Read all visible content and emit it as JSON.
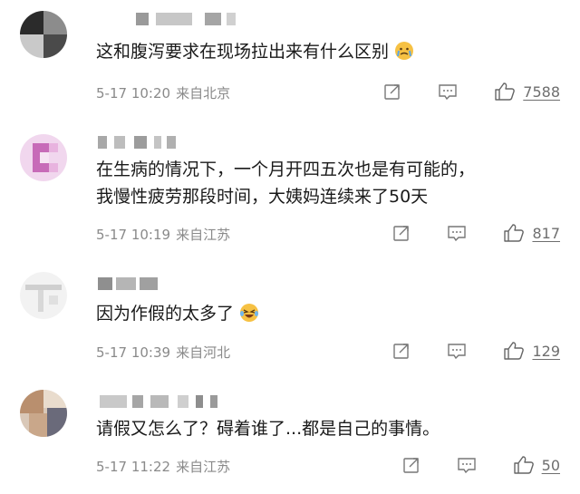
{
  "comments": [
    {
      "text_lines": [
        "这和腹泻要求在现场拉出来有什么区别"
      ],
      "emoji": "crying-face-emoji",
      "date": "5-17",
      "time": "10:20",
      "location": "来自北京",
      "likes": "7588"
    },
    {
      "text_lines": [
        "在生病的情况下，一个月开四五次也是有可能的，",
        "我慢性疲劳那段时间，大姨妈连续来了50天"
      ],
      "emoji": "",
      "date": "5-17",
      "time": "10:19",
      "location": "来自江苏",
      "likes": "817"
    },
    {
      "text_lines": [
        "因为作假的太多了"
      ],
      "emoji": "laughing-crying-emoji",
      "date": "5-17",
      "time": "10:39",
      "location": "来自河北",
      "likes": "129"
    },
    {
      "text_lines": [
        "请假又怎么了？碍着谁了...都是自己的事情。"
      ],
      "emoji": "",
      "date": "5-17",
      "time": "11:22",
      "location": "来自江苏",
      "likes": "50"
    }
  ],
  "icons": {
    "share": "share-icon",
    "reply": "comment-icon",
    "like": "thumbs-up-icon"
  }
}
